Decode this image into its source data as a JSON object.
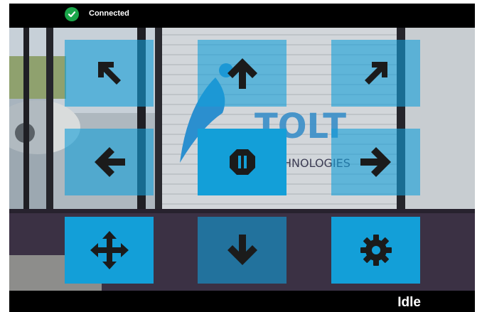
{
  "status": {
    "text": "Connected",
    "icon": "check-circle-icon",
    "color": "#1aa64a"
  },
  "scene_text": {
    "brand": "TOLT",
    "tagline": "HNOLOGIES"
  },
  "controls": {
    "up_left": "arrow-up-left-icon",
    "up": "arrow-up-icon",
    "up_right": "arrow-up-right-icon",
    "left": "arrow-left-icon",
    "stop": "pause-icon",
    "right": "arrow-right-icon",
    "move_mode": "move-icon",
    "down": "arrow-down-icon",
    "settings": "gear-icon"
  },
  "footer": {
    "state": "Idle"
  },
  "colors": {
    "button": "#139fd8",
    "icon": "#1b1b1b",
    "bar": "#000000"
  }
}
